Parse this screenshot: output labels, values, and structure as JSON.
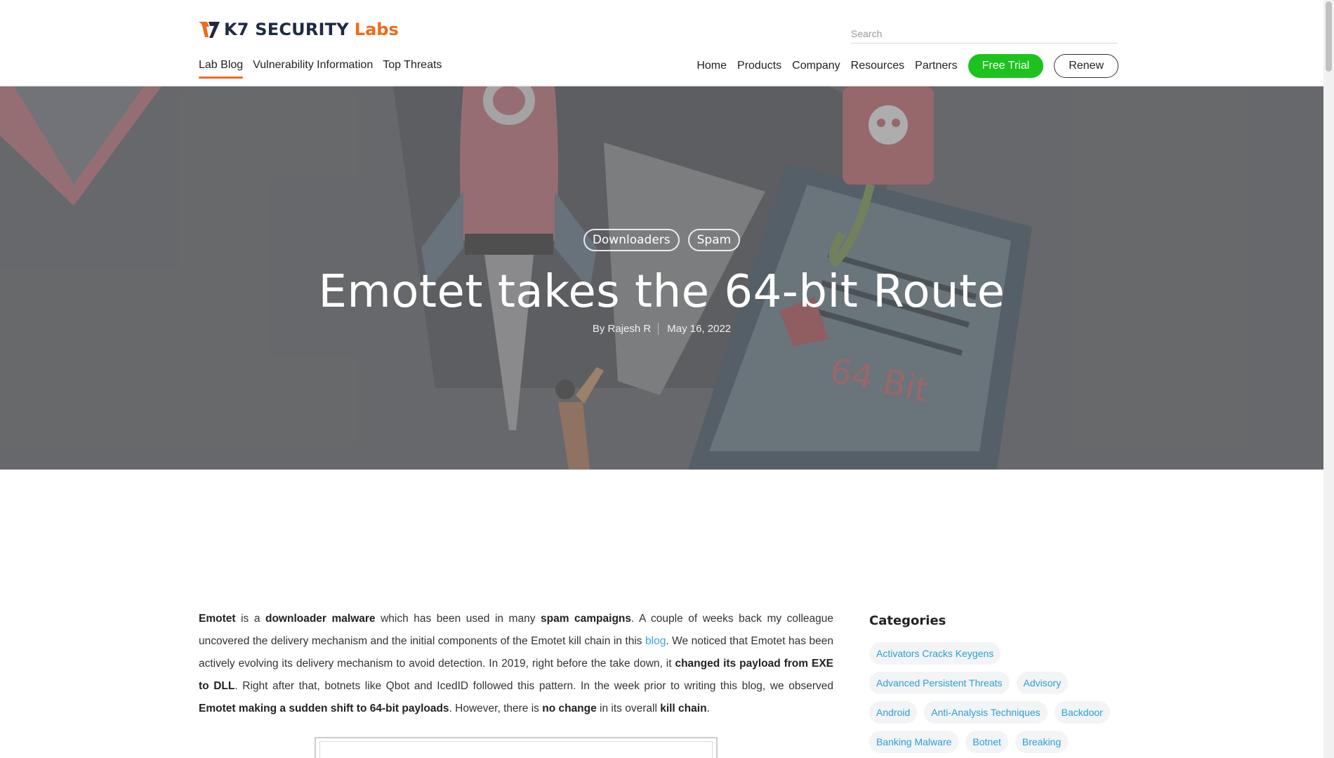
{
  "logo": {
    "brand": "K7 SECURITY",
    "labs": "Labs"
  },
  "search": {
    "placeholder": "Search"
  },
  "subnav": [
    {
      "label": "Lab Blog",
      "active": true
    },
    {
      "label": "Vulnerability Information",
      "active": false
    },
    {
      "label": "Top Threats",
      "active": false
    }
  ],
  "mainnav": {
    "home": "Home",
    "products": "Products",
    "company": "Company",
    "resources": "Resources",
    "partners": "Partners",
    "free_trial": "Free Trial",
    "renew": "Renew"
  },
  "hero": {
    "tags": [
      "Downloaders",
      "Spam"
    ],
    "title": "Emotet takes the 64-bit Route",
    "author": "By Rajesh R",
    "date": "May 16, 2022",
    "illustration_text": "64 Bit"
  },
  "colors": {
    "accent_orange": "#ef6c1a",
    "trial_green": "#1ec21e",
    "link_blue": "#3aa6d6"
  },
  "article": {
    "p1": {
      "s1": "Emotet",
      "s2": " is a ",
      "s3": "downloader malware",
      "s4": " which has been used in many ",
      "s5": "spam campaigns",
      "s6": ". A couple of weeks back my colleague uncovered the delivery mechanism and the initial components of the Emotet kill chain in this ",
      "link": "blog",
      "s7": ". We noticed that Emotet has been actively evolving its delivery mechanism to avoid detection. In 2019, right before the take down, it ",
      "s8": "changed its payload from EXE to DLL",
      "s9": ". Right after that, botnets like Qbot and IcedID followed this pattern.  In the week prior to writing this blog, we observed ",
      "s10": "Emotet making a sudden shift to 64-bit payloads",
      "s11": ". However, there is ",
      "s12": "no change",
      "s13": " in its overall ",
      "s14": "kill chain",
      "s15": "."
    }
  },
  "sidebar": {
    "heading": "Categories",
    "categories": [
      "Activators Cracks Keygens",
      "Advanced Persistent Threats",
      "Advisory",
      "Android",
      "Anti-Analysis Techniques",
      "Backdoor",
      "Banking Malware",
      "Botnet",
      "Breaking"
    ]
  }
}
